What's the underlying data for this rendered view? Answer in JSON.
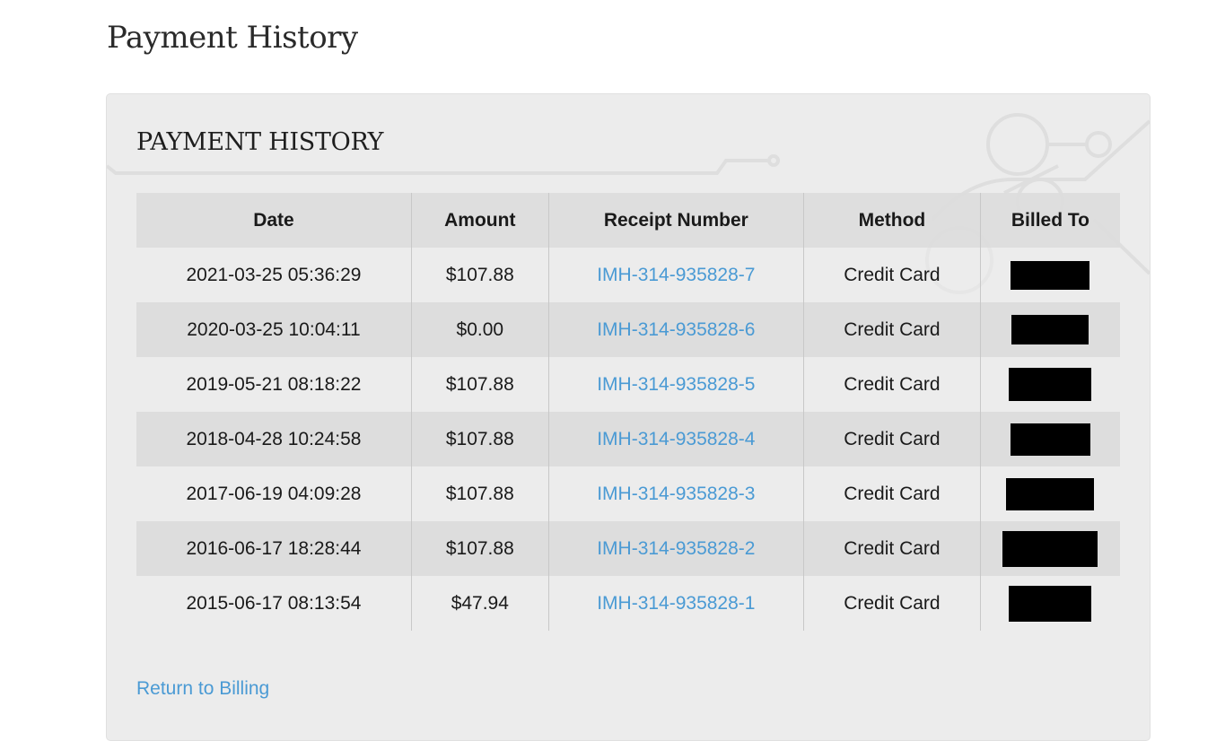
{
  "page": {
    "title": "Payment History"
  },
  "panel": {
    "title": "PAYMENT HISTORY",
    "return_link": "Return to Billing"
  },
  "table": {
    "headers": {
      "date": "Date",
      "amount": "Amount",
      "receipt": "Receipt Number",
      "method": "Method",
      "billed_to": "Billed To"
    },
    "rows": [
      {
        "date": "2021-03-25 05:36:29",
        "amount": "$107.88",
        "receipt": "IMH-314-935828-7",
        "method": "Credit Card",
        "billed_to": "[redacted]"
      },
      {
        "date": "2020-03-25 10:04:11",
        "amount": "$0.00",
        "receipt": "IMH-314-935828-6",
        "method": "Credit Card",
        "billed_to": "[redacted]"
      },
      {
        "date": "2019-05-21 08:18:22",
        "amount": "$107.88",
        "receipt": "IMH-314-935828-5",
        "method": "Credit Card",
        "billed_to": "[redacted]"
      },
      {
        "date": "2018-04-28 10:24:58",
        "amount": "$107.88",
        "receipt": "IMH-314-935828-4",
        "method": "Credit Card",
        "billed_to": "[redacted]"
      },
      {
        "date": "2017-06-19 04:09:28",
        "amount": "$107.88",
        "receipt": "IMH-314-935828-3",
        "method": "Credit Card",
        "billed_to": "[redacted]"
      },
      {
        "date": "2016-06-17 18:28:44",
        "amount": "$107.88",
        "receipt": "IMH-314-935828-2",
        "method": "Credit Card",
        "billed_to": "[redacted]"
      },
      {
        "date": "2015-06-17 08:13:54",
        "amount": "$47.94",
        "receipt": "IMH-314-935828-1",
        "method": "Credit Card",
        "billed_to": "[redacted]"
      }
    ]
  },
  "colors": {
    "link": "#4a9ad4",
    "panel_bg": "#ececec",
    "header_bg": "#dcdcdc",
    "redaction": "#000000"
  }
}
